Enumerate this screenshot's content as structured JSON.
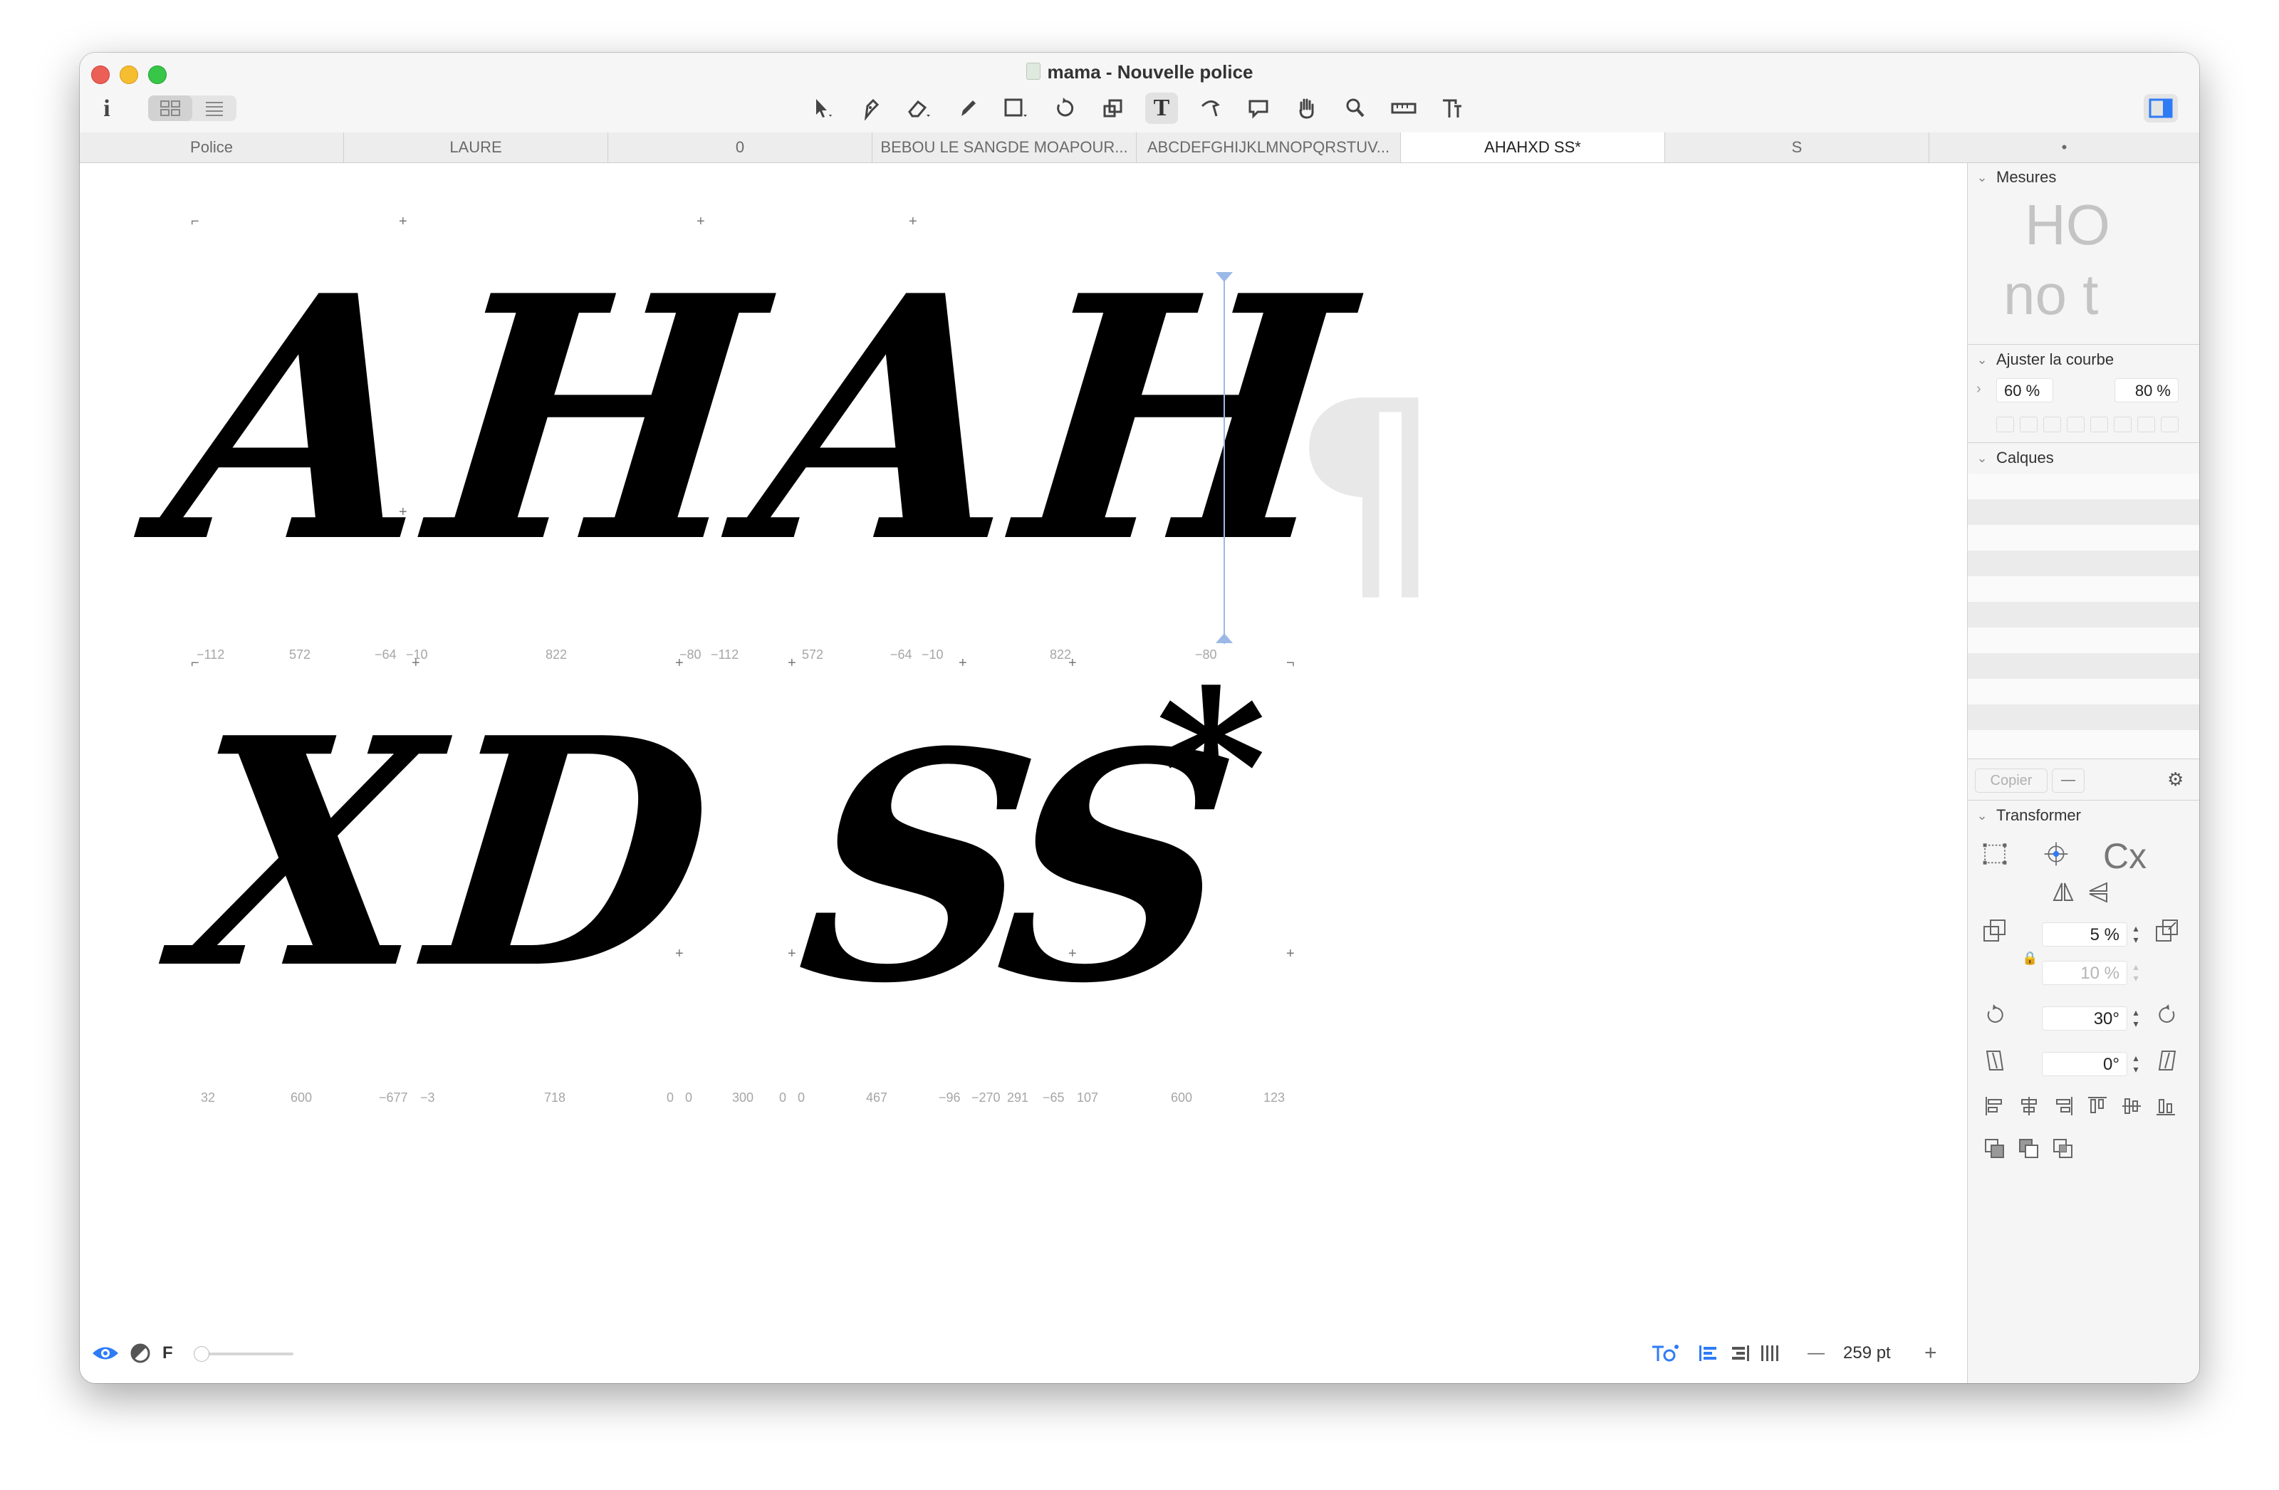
{
  "window": {
    "title": "mama - Nouvelle police",
    "info_label": "i"
  },
  "toolbar": {
    "tools": [
      "select-tool",
      "pen-tool",
      "eraser-tool",
      "pencil-tool",
      "shape-tool",
      "rotate-tool",
      "scale-tool",
      "text-tool",
      "knife-tool",
      "annotation-tool",
      "hand-tool",
      "zoom-tool",
      "measure-tool",
      "type-tool"
    ],
    "active_tool": "text-tool",
    "text_tool_glyph": "T"
  },
  "tabs": [
    {
      "label": "Police"
    },
    {
      "label": "LAURE"
    },
    {
      "label": "0"
    },
    {
      "label": "BEBOU LE SANGDE MOAPOUR..."
    },
    {
      "label": "ABCDEFGHIJKLMNOPQRSTUV..."
    },
    {
      "label": "AHAHXD SS*"
    },
    {
      "label": "S"
    },
    {
      "label": "•"
    }
  ],
  "canvas": {
    "line1_text": "AHAH",
    "line2_text_a": "XD",
    "line2_text_b": "SS",
    "line2_asterisk": "*",
    "pilcrow": "¶",
    "line1_metrics": [
      "−112",
      "572",
      "−64",
      "−10",
      "822",
      "−80",
      "−112",
      "572",
      "−64",
      "−10",
      "822",
      "−80"
    ],
    "line2_metrics": [
      "32",
      "600",
      "−677",
      "−3",
      "718",
      "0",
      "0",
      "300",
      "0",
      "0",
      "467",
      "−96",
      "−270",
      "291",
      "−65",
      "107",
      "600",
      "123"
    ]
  },
  "statusbar": {
    "font_letter": "F",
    "size_value": "259 pt",
    "minus": "—",
    "plus": "+"
  },
  "sidebar": {
    "measures_title": "Mesures",
    "measures_preview_1": "HO",
    "measures_preview_2": "no t",
    "curve_title": "Ajuster la courbe",
    "curve_value_1": "60 %",
    "curve_value_2": "80 %",
    "layers_title": "Calques",
    "copy_button": "Copier",
    "transform_title": "Transformer",
    "cx_label": "Cx",
    "scale_x": "5 %",
    "scale_y": "10 %",
    "rotate_value": "30°",
    "slant_value": "0°"
  },
  "colors": {
    "accent": "#2e7bf6",
    "close": "#ec5f57",
    "minimize": "#f5bd30",
    "maximize": "#37c648"
  }
}
